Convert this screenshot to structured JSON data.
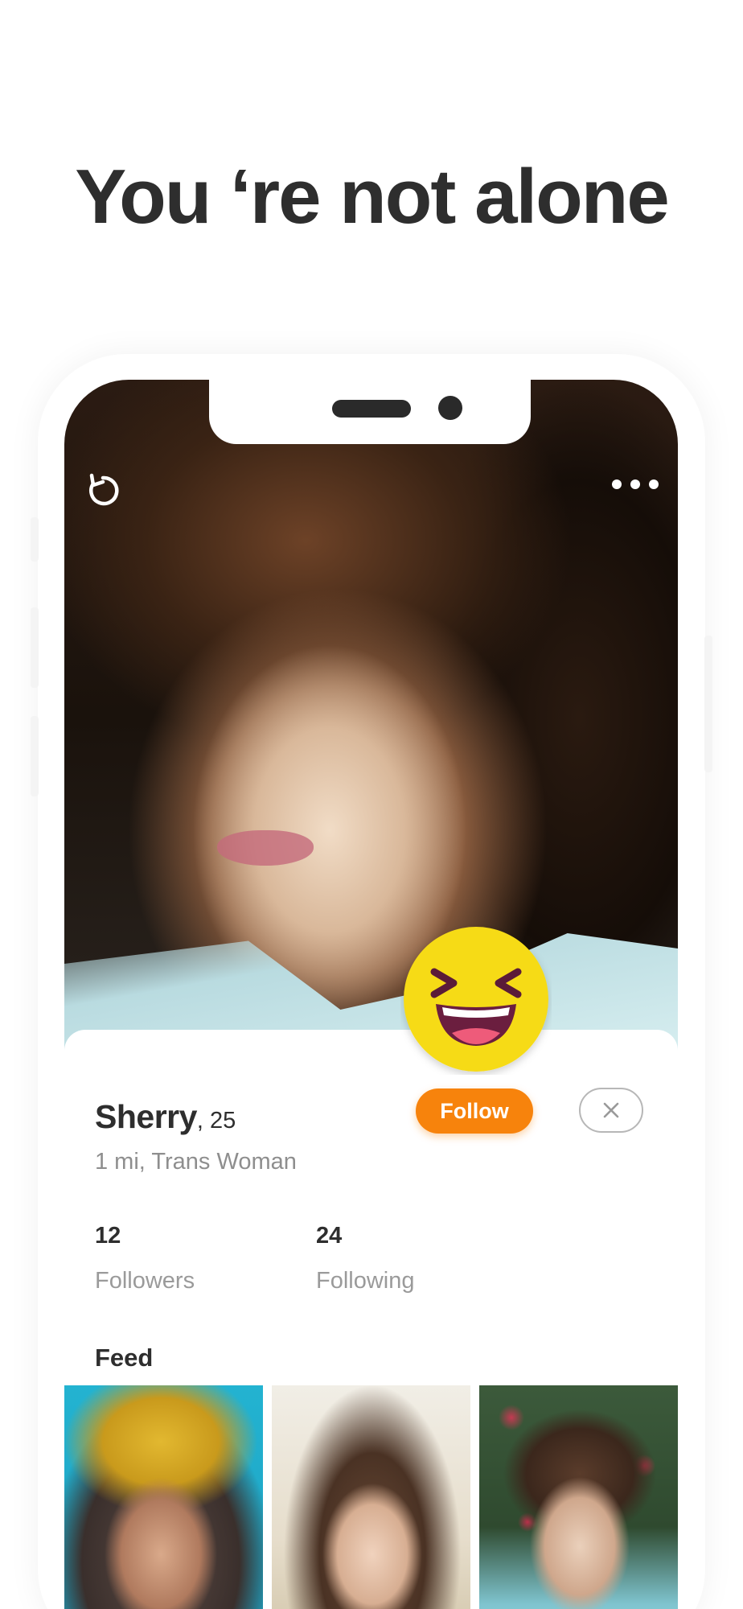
{
  "headline": "You ‘re not alone",
  "profile": {
    "name": "Sherry",
    "age": ", 25",
    "meta": "1 mi, Trans Woman",
    "photo_icon": "profile-photo"
  },
  "actions": {
    "follow_label": "Follow",
    "dismiss_icon": "close-icon",
    "undo_icon": "undo-icon",
    "more_icon": "more-horizontal-icon",
    "emoji_icon": "laughing-emoji-icon"
  },
  "stats": {
    "followers_count": "12",
    "followers_label": "Followers",
    "following_count": "24",
    "following_label": "Following"
  },
  "feed": {
    "title": "Feed",
    "thumbnails": [
      "feed-photo-1",
      "feed-photo-2",
      "feed-photo-3"
    ]
  },
  "colors": {
    "accent": "#f7830c",
    "text_primary": "#2e2e2e",
    "text_secondary": "#8e8e8e",
    "emoji_yellow": "#f6db16"
  }
}
